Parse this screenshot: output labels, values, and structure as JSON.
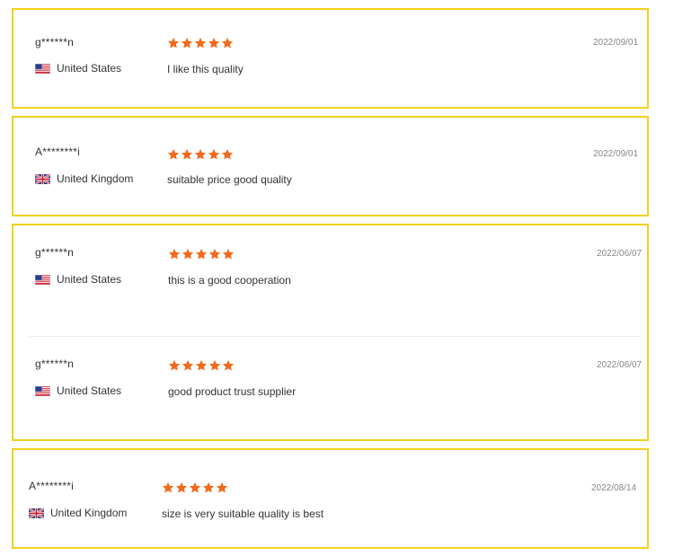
{
  "colors": {
    "border": "#f2d21f",
    "star": "#f26a1b",
    "date_text": "#888888"
  },
  "cards": [
    {
      "reviews": [
        {
          "name": "g******n",
          "country": "United States",
          "flag": "us-flag-icon",
          "rating": 5,
          "comment": "I like this quality",
          "date": "2022/09/01"
        }
      ]
    },
    {
      "reviews": [
        {
          "name": "A********i",
          "country": "United Kingdom",
          "flag": "uk-flag-icon",
          "rating": 5,
          "comment": "suitable price good quality",
          "date": "2022/09/01"
        }
      ]
    },
    {
      "reviews": [
        {
          "name": "g******n",
          "country": "United States",
          "flag": "us-flag-icon",
          "rating": 5,
          "comment": "this is a good cooperation",
          "date": "2022/06/07"
        },
        {
          "name": "g******n",
          "country": "United States",
          "flag": "us-flag-icon",
          "rating": 5,
          "comment": "good product trust supplier",
          "date": "2022/06/07"
        }
      ]
    },
    {
      "reviews": [
        {
          "name": "A********i",
          "country": "United Kingdom",
          "flag": "uk-flag-icon",
          "rating": 5,
          "comment": "size is very suitable quality is best",
          "date": "2022/08/14"
        }
      ]
    }
  ]
}
